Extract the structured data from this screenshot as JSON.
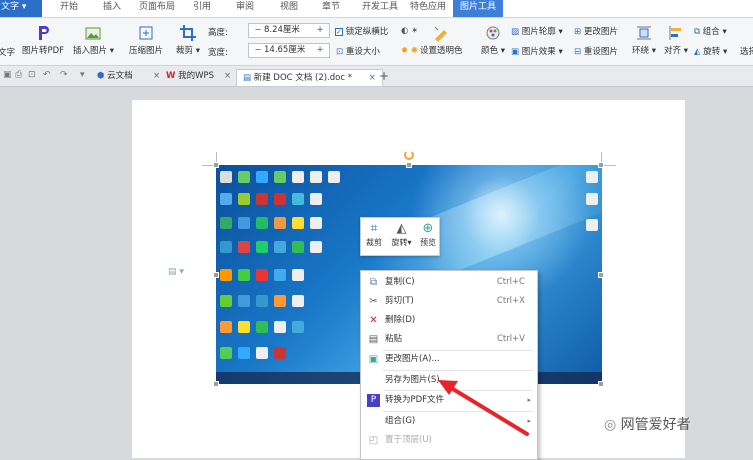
{
  "menu": {
    "file_label": "文字",
    "tabs": [
      "开始",
      "插入",
      "页面布局",
      "引用",
      "审阅",
      "视图",
      "章节",
      "开发工具",
      "特色应用",
      "图片工具"
    ]
  },
  "ribbon": {
    "text_label": "文字",
    "pic_to_pdf": "图片转PDF",
    "insert_picture": "插入图片",
    "compress_picture": "压缩图片",
    "crop": "裁剪",
    "height_label": "高度:",
    "height_value": "8.24厘米",
    "width_label": "宽度:",
    "width_value": "14.65厘米",
    "lock_ratio": "锁定纵横比",
    "reset_size": "重设大小",
    "set_transparent": "设置透明色",
    "color": "颜色",
    "picture_outline": "图片轮廓",
    "picture_effect": "图片效果",
    "change_picture": "更改图片",
    "reset_picture": "重设图片",
    "wrap": "环绕",
    "align": "对齐",
    "combine": "组合",
    "rotate": "旋转",
    "select": "选择"
  },
  "doc_tabs": {
    "cloud_docs": "云文档",
    "my_wps": "我的WPS",
    "current_doc": "新建 DOC 文档 (2).doc *"
  },
  "mini_toolbar": {
    "crop": "裁剪",
    "rotate": "旋转",
    "preview": "预览"
  },
  "context_menu": {
    "items": [
      {
        "label": "复制(C)",
        "shortcut": "Ctrl+C",
        "icon": "copy-icon"
      },
      {
        "label": "剪切(T)",
        "shortcut": "Ctrl+X",
        "icon": "cut-icon"
      },
      {
        "label": "删除(D)",
        "shortcut": "",
        "icon": "delete-icon"
      },
      {
        "label": "粘贴",
        "shortcut": "Ctrl+V",
        "icon": "paste-icon"
      },
      {
        "label": "更改图片(A)...",
        "shortcut": "",
        "icon": "change-picture-icon"
      },
      {
        "label": "另存为图片(S)...",
        "shortcut": "",
        "icon": ""
      },
      {
        "label": "转换为PDF文件",
        "shortcut": "",
        "icon": "pdf-icon"
      },
      {
        "label": "组合(G)",
        "shortcut": "",
        "icon": ""
      },
      {
        "label": "置于顶层(U)",
        "shortcut": "",
        "icon": "bring-front-icon"
      }
    ]
  },
  "watermark": {
    "text": "网管爱好者"
  },
  "colors": {
    "accent": "#2b6fc8",
    "arrow": "#e8242a"
  }
}
